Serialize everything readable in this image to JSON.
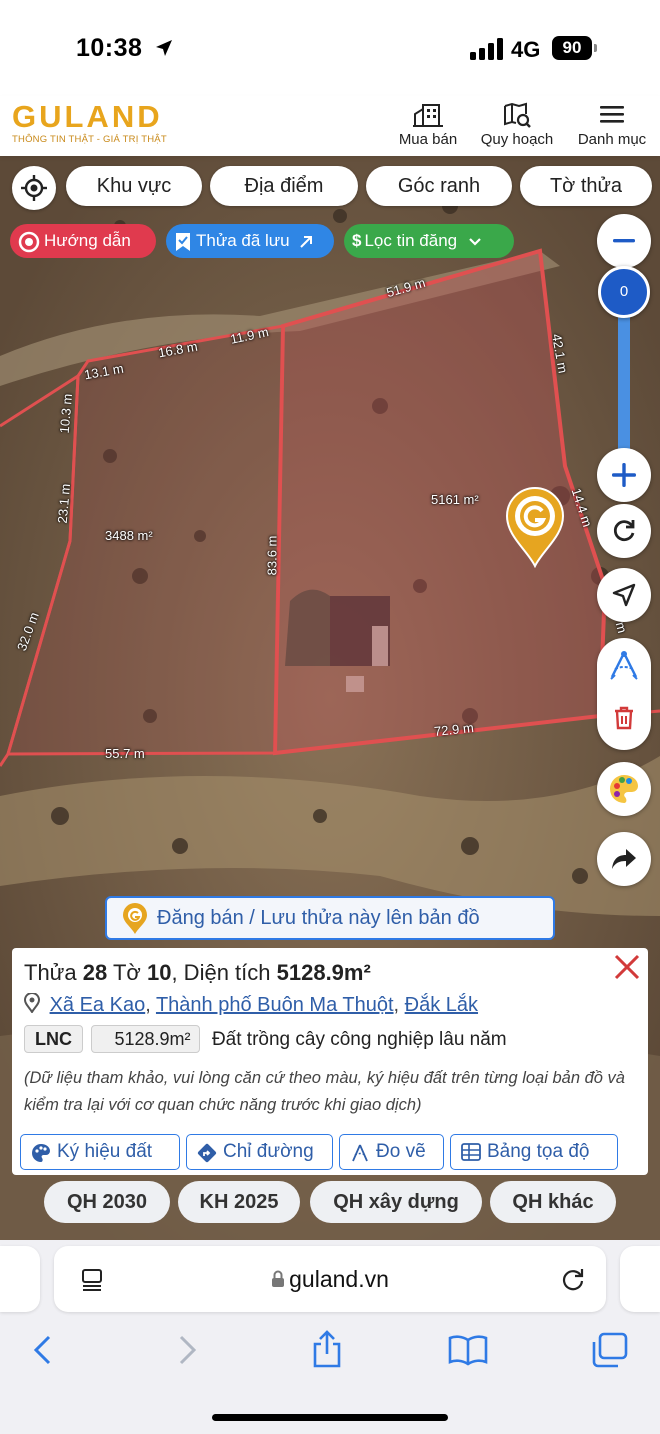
{
  "status": {
    "time": "10:38",
    "network": "4G",
    "battery": "90"
  },
  "header": {
    "logo_text": "GULAND",
    "slogan": "THÔNG TIN THẬT - GIÁ TRỊ THẬT",
    "nav": [
      {
        "label": "Mua bán",
        "icon": "buildings-icon"
      },
      {
        "label": "Quy hoạch",
        "icon": "map-search-icon"
      },
      {
        "label": "Danh mục",
        "icon": "menu-icon"
      }
    ]
  },
  "map": {
    "filters": [
      "Khu vực",
      "Địa điểm",
      "Góc ranh",
      "Tờ thửa"
    ],
    "chips": [
      {
        "label": "Hướng dẫn",
        "color": "#e03a4e"
      },
      {
        "label": "Thửa đã lưu",
        "color": "#2f86e5"
      },
      {
        "label": "Lọc tin đăng",
        "color": "#3aa84a"
      }
    ],
    "zoom_level": "0",
    "measurements": [
      "51.9 m",
      "42.1 m",
      "11.9 m",
      "16.8 m",
      "13.1 m",
      "10.3 m",
      "23.1 m",
      "32.0 m",
      "83.6 m",
      "14.4 m",
      "72.9 m",
      "55.7 m",
      "m"
    ],
    "areas": [
      "5161 m²",
      "3488 m²"
    ],
    "post_banner": "Đăng bán / Lưu thửa này lên bản đồ"
  },
  "parcel": {
    "thua_label": "Thửa",
    "thua": "28",
    "to_label": "Tờ",
    "to": "10",
    "dien_tich_label": ", Diện tích",
    "area": "5128.9m²",
    "commune": "Xã Ea Kao",
    "city": "Thành phố Buôn Ma Thuột",
    "province": "Đắk Lắk",
    "land_code": "LNC",
    "land_area": "5128.9m²",
    "land_type": "Đất trồng cây công nghiệp lâu năm",
    "note": "(Dữ liệu tham khảo, vui lòng căn cứ theo màu, ký hiệu đất trên từng loại bản đồ và kiểm tra lại với cơ quan chức năng trước khi giao dịch)",
    "actions": [
      "Ký hiệu đất",
      "Chỉ đường",
      "Đo vẽ",
      "Bảng tọa độ"
    ]
  },
  "plan_tabs": [
    "QH 2030",
    "KH 2025",
    "QH xây dựng",
    "QH khác"
  ],
  "browser": {
    "url": "guland.vn"
  },
  "colors": {
    "accent": "#2f7ae5",
    "brand": "#e8a51d",
    "parcel_line": "#e05050"
  }
}
